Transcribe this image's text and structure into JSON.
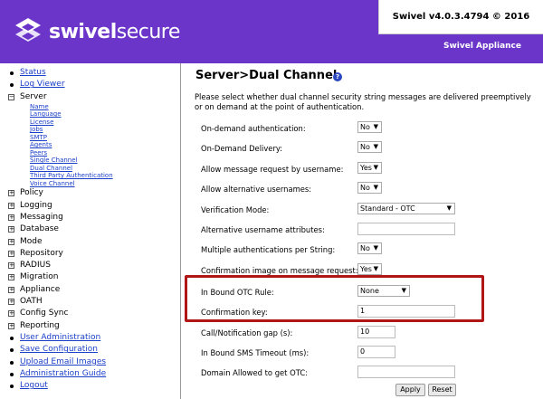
{
  "header": {
    "logo_part1": "swivel",
    "logo_part2": "secure",
    "version": "Swivel v4.0.3.4794 © 2016",
    "appliance": "Swivel Appliance"
  },
  "sidebar": {
    "top_links": [
      "Status",
      "Log Viewer"
    ],
    "server_label": "Server",
    "server_items": [
      "Name",
      "Language",
      "License",
      "Jobs",
      "SMTP",
      "Agents",
      "Peers",
      "Single Channel",
      "Dual Channel",
      "Third Party Authentication",
      "Voice Channel"
    ],
    "sections": [
      "Policy",
      "Logging",
      "Messaging",
      "Database",
      "Mode",
      "Repository",
      "RADIUS",
      "Migration",
      "Appliance",
      "OATH",
      "Config Sync",
      "Reporting"
    ],
    "bottom_links": [
      "User Administration",
      "Save Configuration",
      "Upload Email Images",
      "Administration Guide",
      "Logout"
    ]
  },
  "main": {
    "title": "Server>Dual Channel",
    "description": "Please select whether dual channel security string messages are delivered preemptively or on demand at the point of authentication.",
    "fields": [
      {
        "label": "On-demand authentication:",
        "value": "No",
        "type": "select"
      },
      {
        "label": "On-Demand Delivery:",
        "value": "No",
        "type": "select"
      },
      {
        "label": "Allow message request by username:",
        "value": "Yes",
        "type": "select"
      },
      {
        "label": "Allow alternative usernames:",
        "value": "No",
        "type": "select"
      },
      {
        "label": "Verification Mode:",
        "value": "Standard - OTC",
        "type": "select-wide"
      },
      {
        "label": "Alternative username attributes:",
        "value": "",
        "type": "text"
      },
      {
        "label": "Multiple authentications per String:",
        "value": "No",
        "type": "select"
      },
      {
        "label": "Confirmation image on message request:",
        "value": "Yes",
        "type": "select"
      },
      {
        "label": "In Bound OTC Rule:",
        "value": "None",
        "type": "select-mid"
      },
      {
        "label": "Confirmation key:",
        "value": "1",
        "type": "text"
      },
      {
        "label": "Call/Notification gap (s):",
        "value": "10",
        "type": "text-short"
      },
      {
        "label": "In Bound SMS Timeout (ms):",
        "value": "0",
        "type": "text-short"
      },
      {
        "label": "Domain Allowed to get OTC:",
        "value": "",
        "type": "text"
      }
    ],
    "apply_label": "Apply",
    "reset_label": "Reset",
    "help_symbol": "?"
  },
  "colors": {
    "header": "#6b35c9",
    "link": "#1a3fc8",
    "highlight": "#b01616"
  }
}
